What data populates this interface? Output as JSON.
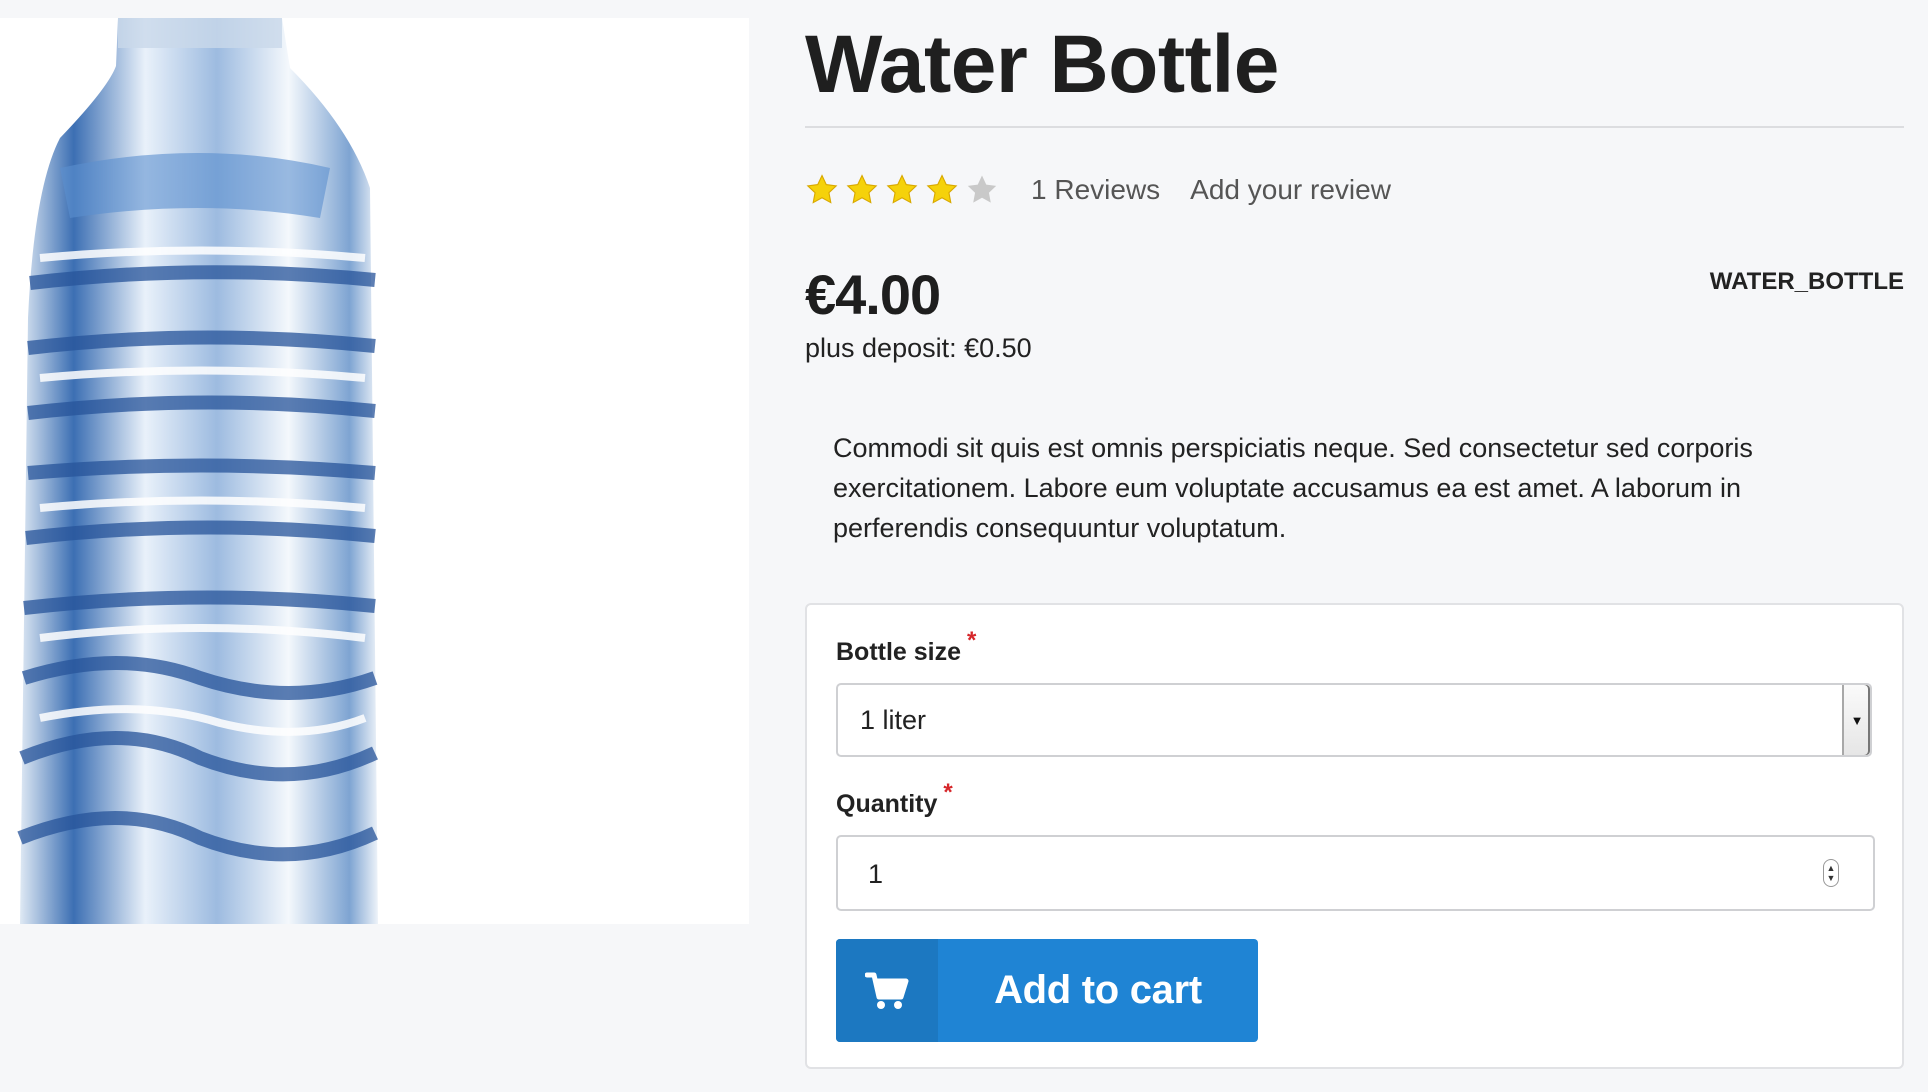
{
  "product": {
    "title": "Water Bottle",
    "image_alt": "water bottle",
    "rating": {
      "value": 4,
      "max": 5,
      "filled_color": "#f5d20b",
      "empty_color": "#c9c9c9"
    },
    "reviews_label": "1 Reviews",
    "add_review_label": "Add your review",
    "price": "€4.00",
    "deposit": "plus deposit: €0.50",
    "sku": "WATER_BOTTLE",
    "description": "Commodi sit quis est omnis perspiciatis neque. Sed consectetur sed corporis exercitationem. Labore eum voluptate accusamus ea est amet. A laborum in perferendis consequuntur voluptatum."
  },
  "form": {
    "bottle_size": {
      "label": "Bottle size",
      "required_mark": "*",
      "value": "1 liter"
    },
    "quantity": {
      "label": "Quantity",
      "required_mark": "*",
      "value": "1"
    },
    "add_to_cart": {
      "label": "Add to cart",
      "icon": "cart-icon",
      "color": "#1f84d4"
    }
  }
}
